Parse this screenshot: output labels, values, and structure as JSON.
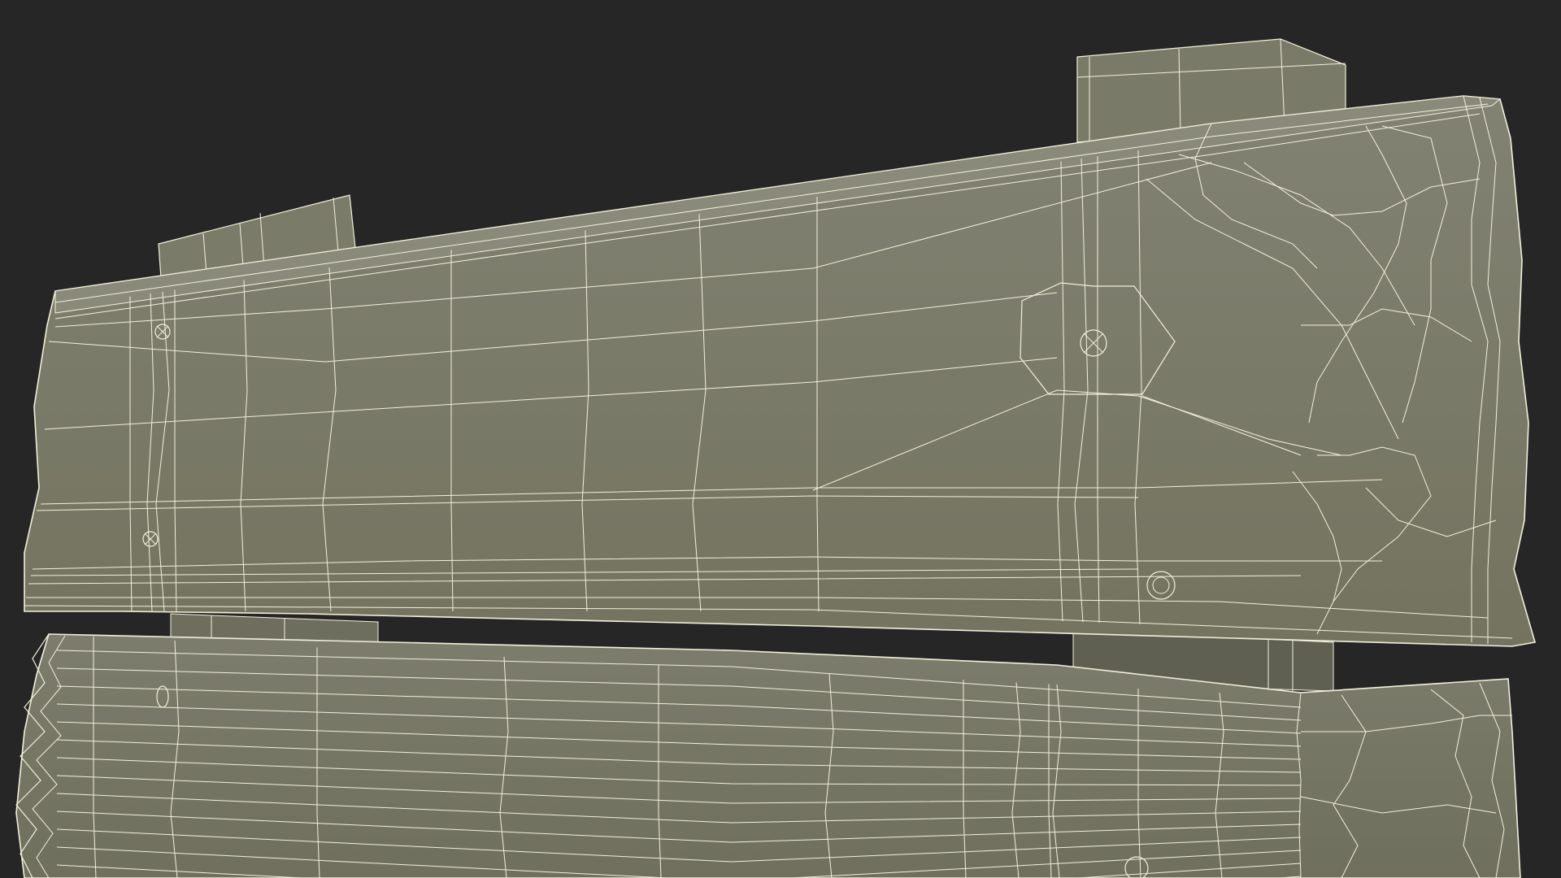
{
  "scene": {
    "background_color": "#262626",
    "mesh_fill_color": "#7a7a6a",
    "mesh_fill_light": "#85857a",
    "mesh_fill_dark": "#5f5f53",
    "wire_color": "#f2f0dc",
    "description_visible_text": ""
  }
}
